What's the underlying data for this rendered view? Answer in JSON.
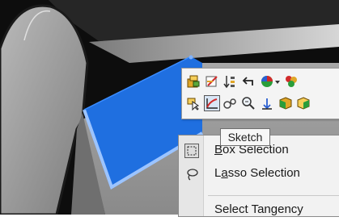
{
  "tooltip": {
    "text": "Sketch"
  },
  "toolbar": {
    "row1": [
      "component-icon",
      "edit-sketch-icon",
      "sort-icon",
      "undo-arrow-icon",
      "appearance-sphere-icon",
      "palette-icon"
    ],
    "row2": [
      "select-arrow-icon",
      "sketch-icon",
      "smart-dimension-icon",
      "zoom-icon",
      "normal-to-icon",
      "view-cube-icon",
      "view-cube-icon-2"
    ],
    "active": "sketch-icon"
  },
  "menu": {
    "items": [
      {
        "label_underlined": "B",
        "label_rest": "ox Selection",
        "icon": "box-selection-icon"
      },
      {
        "label_prefix": "L",
        "label_underlined": "a",
        "label_rest": "sso Selection",
        "icon": "lasso-selection-icon"
      },
      {
        "label": "Select Tangency",
        "icon": ""
      }
    ]
  },
  "colors": {
    "background_dark": "#0d0d0d",
    "model_gray": "#9a9a9a",
    "selected_face": "#1f6fe0",
    "menu_bg": "#f2f2f2"
  }
}
